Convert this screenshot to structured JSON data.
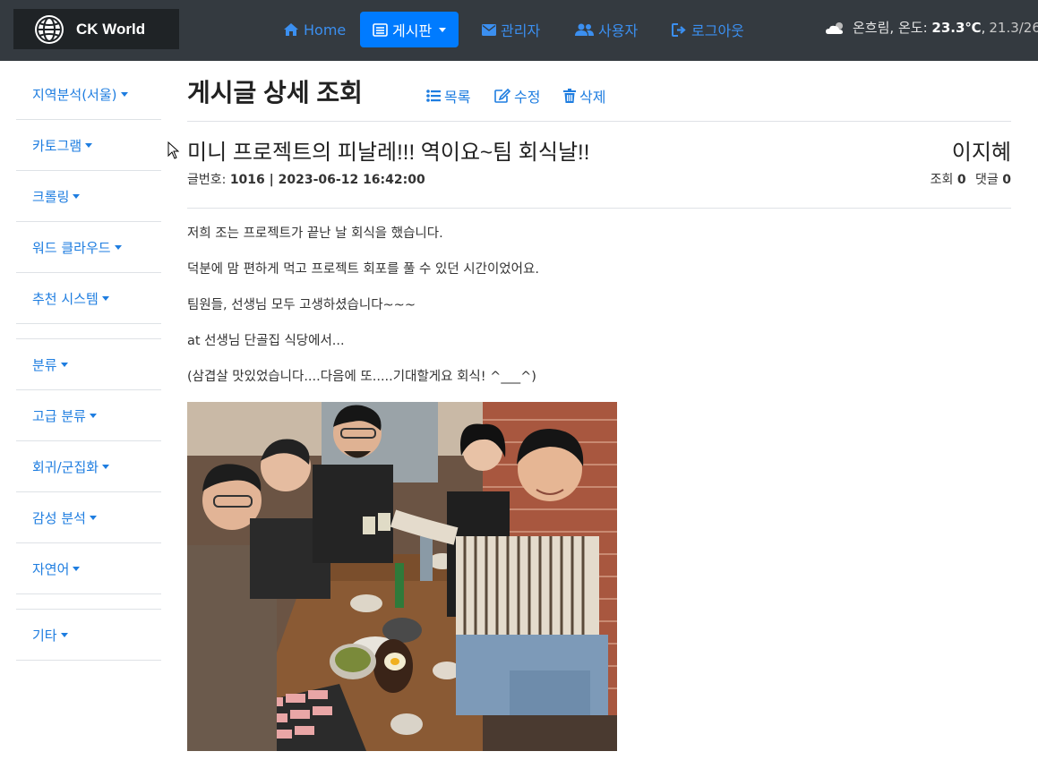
{
  "navbar": {
    "brand": "CK World",
    "items": [
      {
        "label": "Home",
        "icon": "home-icon"
      },
      {
        "label": "게시판",
        "icon": "board-icon",
        "active": true
      },
      {
        "label": "관리자",
        "icon": "envelope-icon"
      },
      {
        "label": "사용자",
        "icon": "users-icon"
      },
      {
        "label": "로그아웃",
        "icon": "sign-out-icon"
      }
    ],
    "weather": {
      "condition": "온흐림",
      "temp_label": "온도",
      "temp_value": "23.3℃",
      "range": "21.3/26."
    }
  },
  "sidebar": {
    "group1": [
      "지역분석(서울)",
      "카토그램",
      "크롤링",
      "워드 클라우드",
      "추천 시스템"
    ],
    "group2": [
      "분류",
      "고급 분류",
      "회귀/군집화",
      "감성 분석",
      "자연어"
    ],
    "group3": [
      "기타"
    ]
  },
  "page": {
    "title": "게시글 상세 조회",
    "actions": {
      "list": "목록",
      "edit": "수정",
      "delete": "삭제"
    }
  },
  "post": {
    "title": "미니 프로젝트의 피날레!!! 역이요~팀 회식날!!",
    "author": "이지혜",
    "meta_label": "글번호:",
    "meta_value": "1016 | 2023-06-12 16:42:00",
    "views_label": "조회",
    "views": "0",
    "comments_label": "댓글",
    "comments": "0",
    "lines": [
      "저희 조는 프로젝트가 끝난 날 회식을 했습니다.",
      "덕분에 맘 편하게 먹고 프로젝트 회포를 풀 수 있던 시간이었어요.",
      "팀원들, 선생님 모두 고생하셨습니다~~~",
      "at 선생님 단골집 식당에서...",
      "(삼겹살 맛있었습니다....다음에 또.....기대할게요 회식! ^___^)"
    ]
  },
  "colors": {
    "navbar_bg": "#343a40",
    "accent": "#007bff",
    "link": "#1e7de0"
  }
}
